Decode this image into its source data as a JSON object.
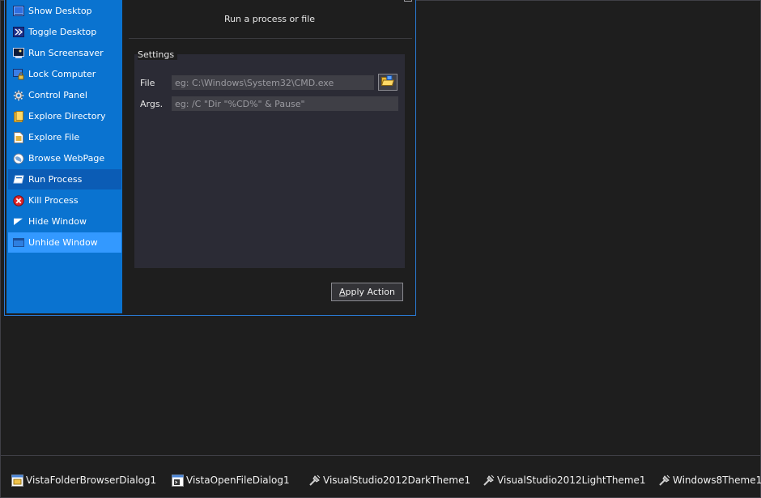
{
  "sidebar": {
    "items": [
      {
        "label": "Show Desktop",
        "icon": "show-desktop-icon"
      },
      {
        "label": "Toggle Desktop",
        "icon": "toggle-desktop-icon"
      },
      {
        "label": "Run Screensaver",
        "icon": "screensaver-icon"
      },
      {
        "label": "Lock Computer",
        "icon": "lock-computer-icon"
      },
      {
        "label": "Control Panel",
        "icon": "control-panel-icon"
      },
      {
        "label": "Explore Directory",
        "icon": "folder-icon"
      },
      {
        "label": "Explore File",
        "icon": "file-icon"
      },
      {
        "label": "Browse WebPage",
        "icon": "globe-icon"
      },
      {
        "label": "Run Process",
        "icon": "run-process-icon",
        "state": "active"
      },
      {
        "label": "Kill Process",
        "icon": "kill-process-icon"
      },
      {
        "label": "Hide Window",
        "icon": "hide-window-icon"
      },
      {
        "label": "Unhide Window",
        "icon": "unhide-window-icon",
        "state": "selected"
      }
    ]
  },
  "content": {
    "title": "Run a process or file",
    "settings_caption": "Settings",
    "file_label": "File",
    "file_placeholder": "eg: C:\\Windows\\System32\\CMD.exe",
    "file_value": "",
    "args_label": "Args.",
    "args_placeholder": "eg: /C \"Dir \"%CD%\" & Pause\"",
    "args_value": "",
    "apply_button": {
      "mnemonic": "A",
      "rest": "pply Action"
    }
  },
  "tray": {
    "items": [
      {
        "label": "VistaFolderBrowserDialog1",
        "icon": "folder-browser-dialog-icon"
      },
      {
        "label": "VistaOpenFileDialog1",
        "icon": "open-file-dialog-icon"
      },
      {
        "label": "VisualStudio2012DarkTheme1",
        "icon": "theme-component-icon"
      },
      {
        "label": "VisualStudio2012LightTheme1",
        "icon": "theme-component-icon"
      },
      {
        "label": "Windows8Theme1",
        "icon": "theme-component-icon"
      }
    ]
  },
  "colors": {
    "sidebar": "#0a73d0",
    "sidebar_active": "#0b5cb5",
    "sidebar_selected": "#3399ff",
    "background": "#1e1e1e",
    "group_background": "#2b2b35",
    "input_background": "#3f3f46"
  }
}
